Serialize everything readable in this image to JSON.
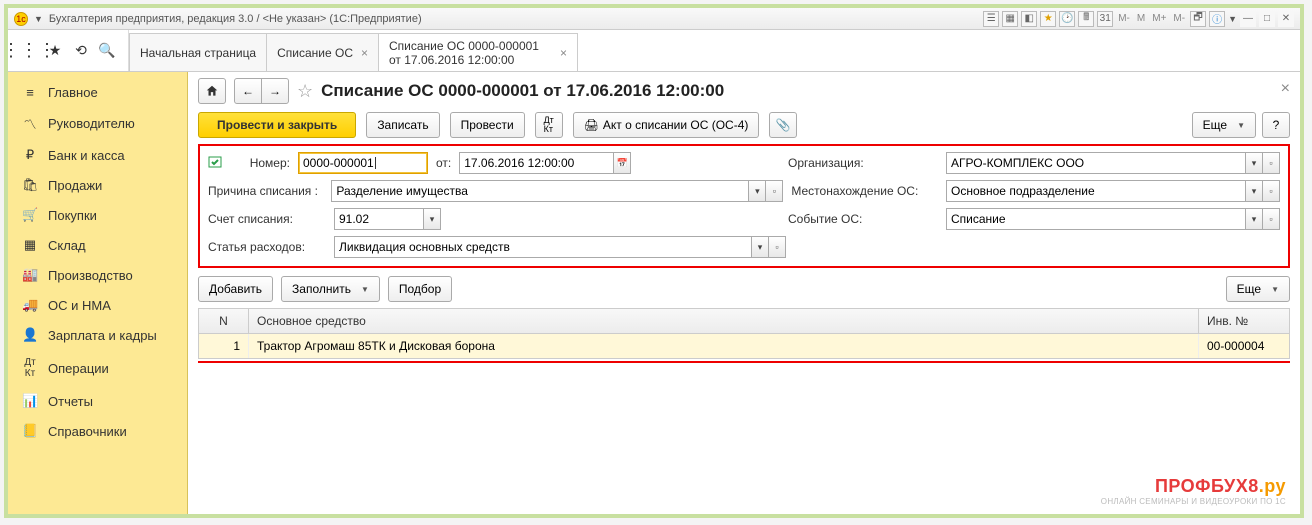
{
  "window": {
    "title": "Бухгалтерия предприятия, редакция 3.0 / <Не указан>  (1С:Предприятие)"
  },
  "tabs": {
    "items": [
      {
        "label": "Начальная страница",
        "closable": false
      },
      {
        "label": "Списание ОС",
        "closable": true
      },
      {
        "label": "Списание ОС 0000-000001 от 17.06.2016 12:00:00",
        "closable": true
      }
    ]
  },
  "sidebar": {
    "items": [
      {
        "label": "Главное"
      },
      {
        "label": "Руководителю"
      },
      {
        "label": "Банк и касса"
      },
      {
        "label": "Продажи"
      },
      {
        "label": "Покупки"
      },
      {
        "label": "Склад"
      },
      {
        "label": "Производство"
      },
      {
        "label": "ОС и НМА"
      },
      {
        "label": "Зарплата и кадры"
      },
      {
        "label": "Операции"
      },
      {
        "label": "Отчеты"
      },
      {
        "label": "Справочники"
      }
    ]
  },
  "page": {
    "title": "Списание ОС 0000-000001 от 17.06.2016 12:00:00"
  },
  "toolbar": {
    "post_and_close": "Провести и закрыть",
    "write": "Записать",
    "post": "Провести",
    "print_act": "Акт о списании ОС (ОС-4)",
    "more": "Еще"
  },
  "form": {
    "number_label": "Номер:",
    "number_value": "0000-000001",
    "date_label": "от:",
    "date_value": "17.06.2016 12:00:00",
    "org_label": "Организация:",
    "org_value": "АГРО-КОМПЛЕКС ООО",
    "reason_label": "Причина списания :",
    "reason_value": "Разделение имущества",
    "location_label": "Местонахождение ОС:",
    "location_value": "Основное подразделение",
    "account_label": "Счет списания:",
    "account_value": "91.02",
    "event_label": "Событие ОС:",
    "event_value": "Списание",
    "expense_label": "Статья расходов:",
    "expense_value": "Ликвидация основных средств"
  },
  "subtoolbar": {
    "add": "Добавить",
    "fill": "Заполнить",
    "pick": "Подбор",
    "more": "Еще"
  },
  "table": {
    "col_n": "N",
    "col_asset": "Основное средство",
    "col_inv": "Инв. №",
    "rows": [
      {
        "n": "1",
        "asset": "Трактор Агромаш 85ТК и Дисковая борона",
        "inv": "00-000004"
      }
    ]
  },
  "watermark": {
    "brand": "ПРОФБУХ8",
    "suffix": ".ру",
    "tag": "ОНЛАЙН СЕМИНАРЫ И ВИДЕОУРОКИ ПО 1С"
  },
  "zoom_levels": [
    "M-",
    "M",
    "M+",
    "M-"
  ]
}
